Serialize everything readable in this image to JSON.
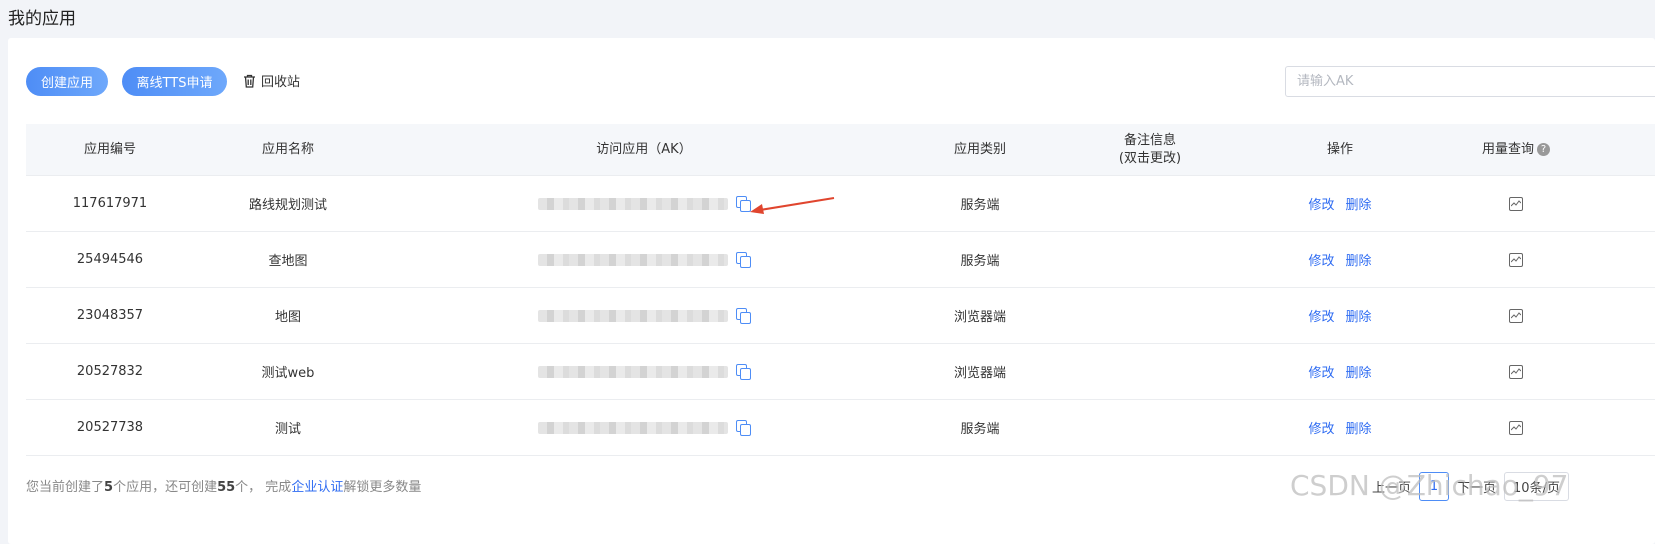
{
  "page": {
    "title": "我的应用"
  },
  "toolbar": {
    "create_label": "创建应用",
    "tts_label": "离线TTS申请",
    "recycle_label": "回收站",
    "search_placeholder": "请输入AK"
  },
  "table": {
    "headers": {
      "id": "应用编号",
      "name": "应用名称",
      "ak": "访问应用（AK）",
      "type": "应用类别",
      "note_line1": "备注信息",
      "note_line2": "(双击更改)",
      "op": "操作",
      "usage": "用量查询"
    },
    "edit_label": "修改",
    "delete_label": "删除",
    "rows": [
      {
        "id": "117617971",
        "name": "路线规划测试",
        "type": "服务端"
      },
      {
        "id": "25494546",
        "name": "查地图",
        "type": "服务端"
      },
      {
        "id": "23048357",
        "name": "地图",
        "type": "浏览器端"
      },
      {
        "id": "20527832",
        "name": "测试web",
        "type": "浏览器端"
      },
      {
        "id": "20527738",
        "name": "测试",
        "type": "服务端"
      }
    ]
  },
  "footer": {
    "pre": "您当前创建了",
    "created": "5",
    "mid": "个应用，还可创建",
    "remaining": "55",
    "post": "个，  完成",
    "link": "企业认证",
    "tail": "解锁更多数量"
  },
  "pager": {
    "prev": "上一页",
    "current": "1",
    "next": "下一页",
    "size": "10条/页"
  },
  "watermark": "CSDN @Zhichao_97",
  "colors": {
    "accent": "#4e8df6",
    "link": "#2f6cf2",
    "arrow": "#e0452e"
  }
}
